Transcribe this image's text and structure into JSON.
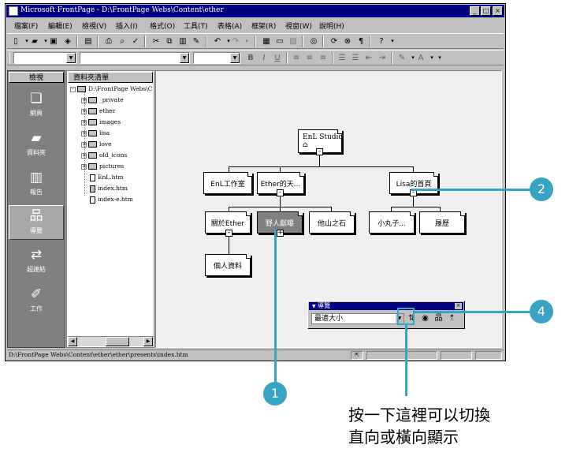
{
  "window": {
    "title": "Microsoft FrontPage - D:\\FrontPage Webs\\Content\\ether",
    "controls": {
      "minimize": "_",
      "maximize": "□",
      "close": "×"
    }
  },
  "menu": [
    "檔案(F)",
    "編輯(E)",
    "檢視(V)",
    "插入(I)",
    "格式(O)",
    "工具(T)",
    "表格(A)",
    "框架(R)",
    "視窗(W)",
    "說明(H)"
  ],
  "format_toolbar": {
    "bold": "B",
    "italic": "I",
    "underline": "U"
  },
  "views_bar": {
    "header": "檢視",
    "items": [
      {
        "label": "網頁",
        "icon": "page-view-icon"
      },
      {
        "label": "資料夾",
        "icon": "folders-view-icon"
      },
      {
        "label": "報告",
        "icon": "reports-view-icon"
      },
      {
        "label": "導覽",
        "icon": "navigation-view-icon"
      },
      {
        "label": "超連結",
        "icon": "hyperlinks-view-icon"
      },
      {
        "label": "工作",
        "icon": "tasks-view-icon"
      }
    ]
  },
  "folder_list": {
    "header": "資料夾清單",
    "root": "D:\\FrontPage Webs\\C",
    "folders": [
      "_private",
      "ether",
      "images",
      "lisa",
      "love",
      "old_icons",
      "pictures"
    ],
    "files": [
      "EnL.htm",
      "index.htm",
      "index-e.htm"
    ]
  },
  "navigation": {
    "root": "EnL Studio",
    "level1": [
      "EnL工作室",
      "Ether的天...",
      "Lisa的首頁"
    ],
    "ether_children": [
      "關於Ether",
      "野人獻曝",
      "他山之石"
    ],
    "about_child": "個人資料",
    "lisa_children": [
      "小丸子...",
      "履歷"
    ]
  },
  "nav_toolbar": {
    "title": "導覽",
    "zoom": "最適大小"
  },
  "status_bar": {
    "path": "D:\\FrontPage Webs\\Content\\ether\\ether\\presents\\index.htm"
  },
  "callouts": [
    "1",
    "2",
    "4"
  ],
  "caption": [
    "按一下這裡可以切換",
    "直向或橫向顯示"
  ]
}
